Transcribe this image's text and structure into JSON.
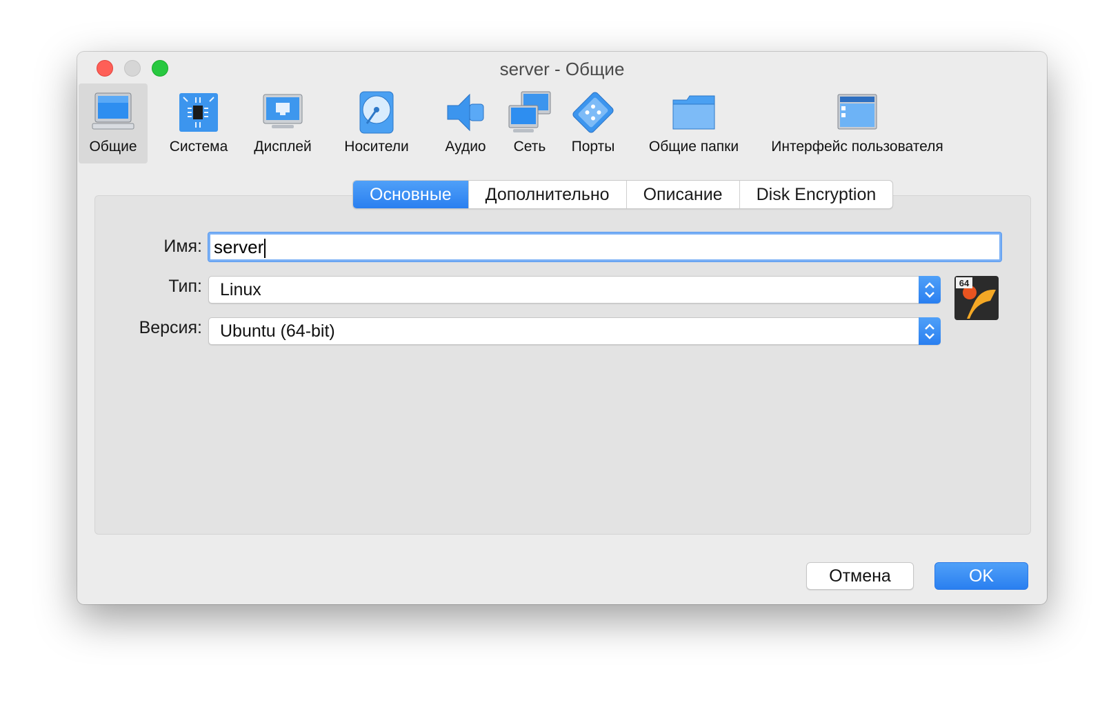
{
  "window": {
    "title": "server - Общие"
  },
  "toolbar": {
    "items": [
      {
        "label": "Общие",
        "icon": "computer-icon",
        "active": true
      },
      {
        "label": "Система",
        "icon": "chip-icon"
      },
      {
        "label": "Дисплей",
        "icon": "display-icon"
      },
      {
        "label": "Носители",
        "icon": "disk-icon"
      },
      {
        "label": "Аудио",
        "icon": "speaker-icon"
      },
      {
        "label": "Сеть",
        "icon": "network-icon"
      },
      {
        "label": "Порты",
        "icon": "port-icon"
      },
      {
        "label": "Общие папки",
        "icon": "folder-icon"
      },
      {
        "label": "Интерфейс пользователя",
        "icon": "window-icon"
      }
    ]
  },
  "tabs": [
    {
      "label": "Основные",
      "active": true
    },
    {
      "label": "Дополнительно"
    },
    {
      "label": "Описание"
    },
    {
      "label": "Disk Encryption"
    }
  ],
  "form": {
    "name_label": "Имя:",
    "name_value": "server",
    "type_label": "Тип:",
    "type_value": "Linux",
    "version_label": "Версия:",
    "version_value": "Ubuntu (64-bit)",
    "os_badge": "64"
  },
  "buttons": {
    "cancel": "Отмена",
    "ok": "OK"
  },
  "colors": {
    "accent": "#2a7ff0",
    "close": "#fe5f57",
    "zoom": "#28c840",
    "window_bg": "#ececec"
  }
}
